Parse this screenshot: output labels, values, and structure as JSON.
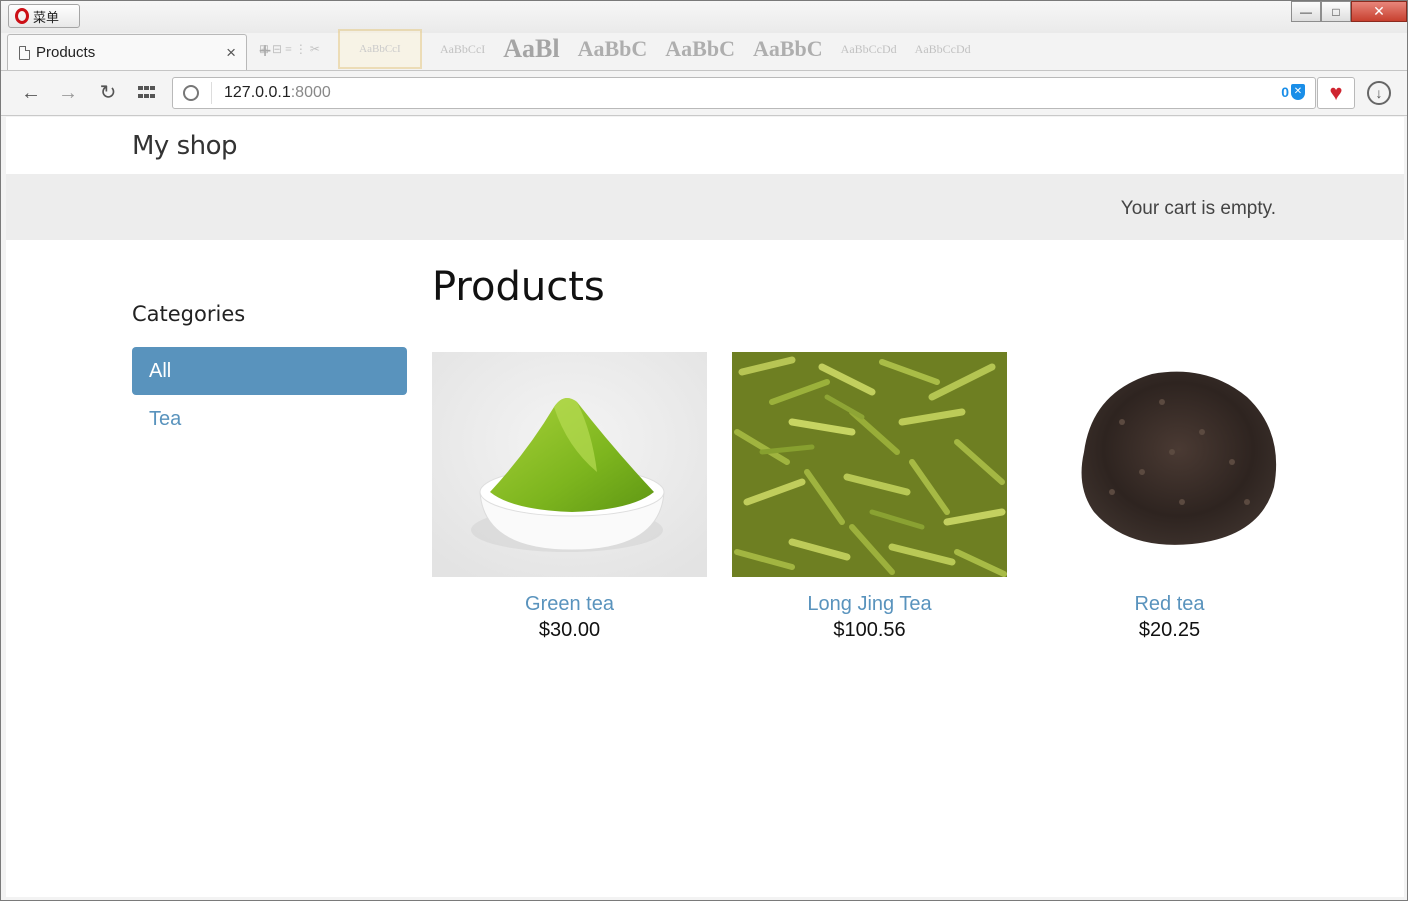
{
  "browser": {
    "menu_label": "菜单",
    "tab_title": "Products",
    "tab_close": "×",
    "new_tab": "+",
    "url_host": "127.0.0.1",
    "url_port": ":8000",
    "adblock_count": "0",
    "faint_styles": [
      "AaBbCcI",
      "AaBbCcI",
      "AaBl",
      "AaBbC",
      "AaBbC",
      "AaBbC",
      "AaBbCcDd",
      "AaBbCcDd"
    ]
  },
  "window_controls": {
    "minimize": "—",
    "maximize": "□",
    "close": "✕"
  },
  "site": {
    "brand": "My shop",
    "cart_status": "Your cart is empty."
  },
  "sidebar": {
    "heading": "Categories",
    "items": [
      {
        "label": "All",
        "active": true
      },
      {
        "label": "Tea",
        "active": false
      }
    ]
  },
  "main": {
    "heading": "Products",
    "products": [
      {
        "name": "Green tea",
        "price": "$30.00",
        "image": "matcha powder bowl"
      },
      {
        "name": "Long Jing Tea",
        "price": "$100.56",
        "image": "green tea leaves"
      },
      {
        "name": "Red tea",
        "price": "$20.25",
        "image": "black tea leaves pile"
      }
    ]
  },
  "colors": {
    "accent": "#5993bd",
    "cart_bar": "#ededed",
    "close_button": "#c7402f",
    "heart": "#cf2530",
    "adblock": "#1a8ee8"
  }
}
